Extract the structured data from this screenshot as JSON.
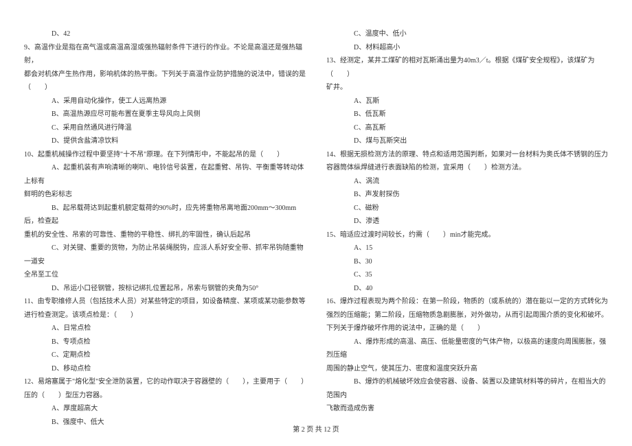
{
  "left": {
    "q8_d": "D、42",
    "q9_stem1": "9、高温作业是指在高气温或高温高湿或强热辐射条件下进行的作业。不论是高温还是强热辐射，",
    "q9_stem2": "都会对机体产生热作用，影响机体的热平衡。下列关于高温作业防护措施的说法中，错误的是",
    "q9_stem3": "（　　）",
    "q9_a": "A、采用自动化操作，使工人远离热源",
    "q9_b": "B、高温热源应尽可能布置在夏季主导风向上风侧",
    "q9_c": "C、采用自然通风进行降温",
    "q9_d": "D、提供含盐清凉饮料",
    "q10_stem": "10、起重机械操作过程中要坚持\"十不吊\"原理。在下列情形中，不能起吊的是（　　）",
    "q10_a1": "A、起重机装有声响清晰的喇叭、电铃信号装置，在起重臂、吊钩、平衡重等转动体上标有",
    "q10_a2": "鲜明的色彩标志",
    "q10_b1": "B、起吊载荷达到起重机额定载荷的90%时，应先将重物吊离地面200mm～300mm后，检查起",
    "q10_b2": "重机的安全性、吊索的可靠性、重物的平稳性、绑扎的牢固性，确认后起吊",
    "q10_c1": "C、对关键、重要的货物，为防止吊装绳脱钩，应派人系好安全带、抓牢吊钩随重物一道安",
    "q10_c2": "全吊至工位",
    "q10_d": "D、吊运小口径钢管，按标记绑扎位置起吊，吊索与钢管的夹角为50°",
    "q11_stem1": "11、由专职维修人员（包括技术人员）对某些特定的项目，如设备精度、某项或某功能参数等",
    "q11_stem2": "进行检查测定。该项点检是：（　　）",
    "q11_a": "A、日常点检",
    "q11_b": "B、专项点检",
    "q11_c": "C、定期点检",
    "q11_d": "D、移动点检",
    "q12_stem1": "12、易熔塞属于\"熔化型\"安全泄防装置，它的动作取决于容器壁的（　　），主要用于（　　）",
    "q12_stem2": "压的（　　）型压力容器。",
    "q12_a": "A、厚度超高大",
    "q12_b": "B、强度中、低大"
  },
  "right": {
    "q12_c": "C、温度中、低小",
    "q12_d": "D、材料超高小",
    "q13_stem1": "13、经测定，某井工煤矿的相对瓦斯涌出量为40m3／t。根据《煤矿安全规程》，该煤矿为（　　）",
    "q13_stem2": "矿井。",
    "q13_a": "A、瓦斯",
    "q13_b": "B、低瓦斯",
    "q13_c": "C、高瓦斯",
    "q13_d": "D、煤与瓦斯突出",
    "q14_stem1": "14、根据无损检测方法的原理、特点和适用范围判断，如果对一台材料为奥氏体不锈钢的压力",
    "q14_stem2": "容器筒体纵焊缝进行表面缺陷的检测，宜采用（　　）检测方法。",
    "q14_a": "A、涡流",
    "q14_b": "B、声发射探伤",
    "q14_c": "C、磁粉",
    "q14_d": "D、渗透",
    "q15_stem": "15、暗适应过渡时间较长，约需（　　）min才能完成。",
    "q15_a": "A、15",
    "q15_b": "B、30",
    "q15_c": "C、35",
    "q15_d": "D、40",
    "q16_stem1": "16、爆炸过程表现为两个阶段：在第一阶段，物质的（或系统的）潜在能以一定的方式转化为",
    "q16_stem2": "强烈的压缩能；第二阶段，压缩物质急剧膨胀，对外做功，从而引起周围介质的变化和破坏。",
    "q16_stem3": "下列关于爆炸破坏作用的说法中，正确的是（　　）",
    "q16_a1": "A、爆炸形成的高温、高压、低能量密度的气体产物，以极高的速度向周围膨胀，强烈压缩",
    "q16_a2": "周围的静止空气，使其压力、密度和温度突跃升高",
    "q16_b1": "B、爆炸的机械破坏效应会使容器、设备、装置以及建筑材料等的碎片，在相当大的范围内",
    "q16_b2": "飞散而造成伤害"
  },
  "footer": "第 2 页 共 12 页"
}
